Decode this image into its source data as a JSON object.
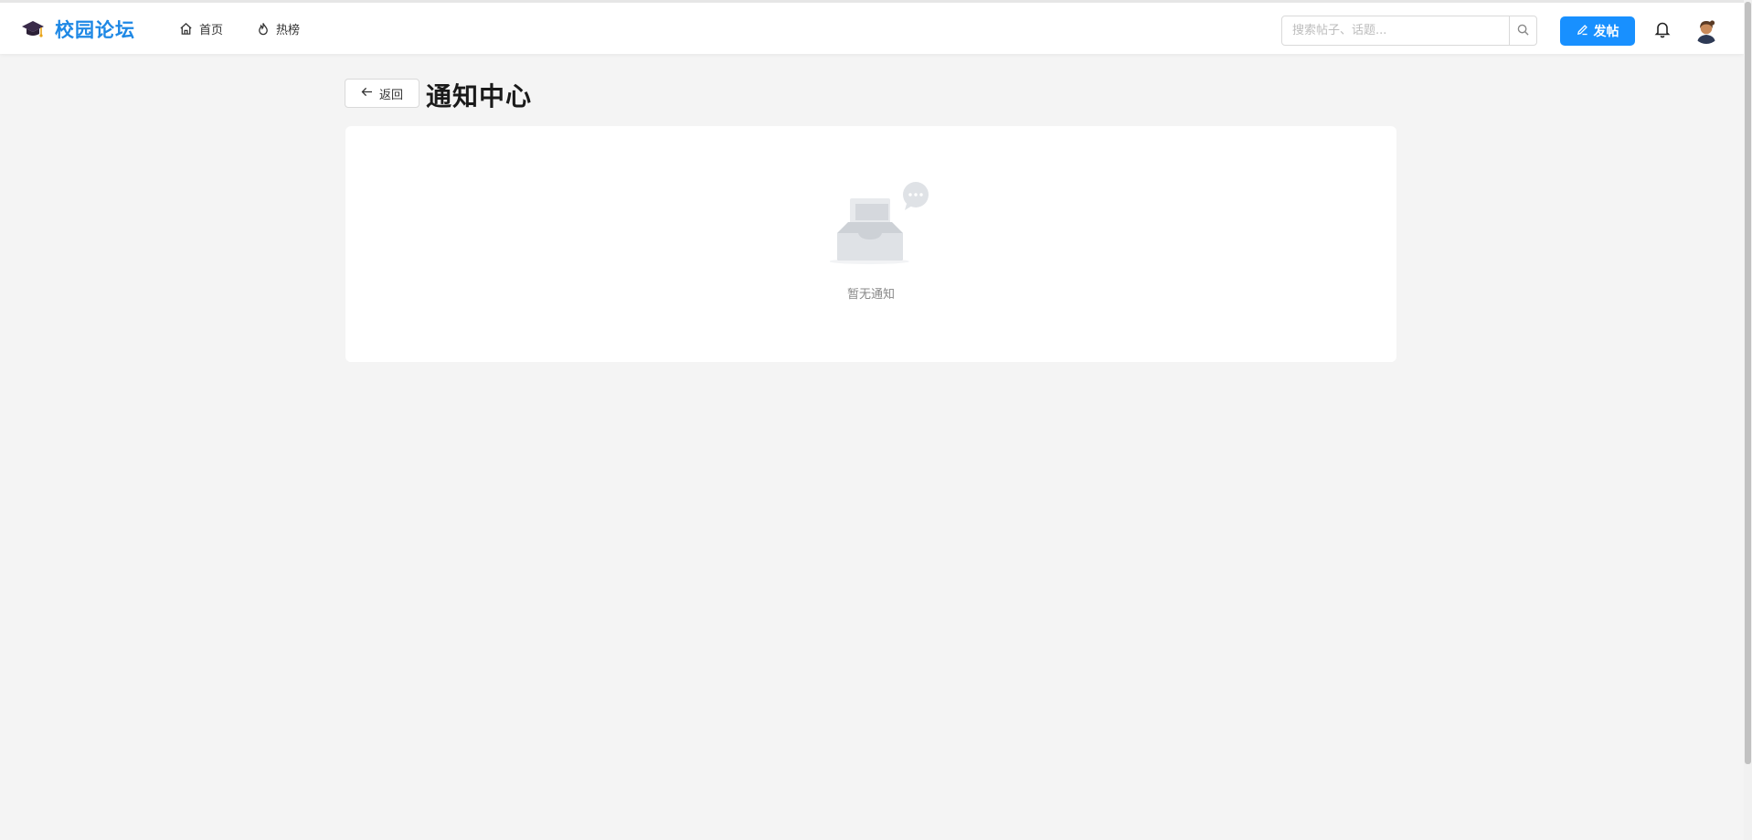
{
  "app": {
    "brand_name": "校园论坛",
    "brand_icon": "graduation-cap-icon",
    "accent_color": "#1890ff"
  },
  "nav": {
    "items": [
      {
        "label": "首页",
        "icon": "home-icon"
      },
      {
        "label": "热榜",
        "icon": "flame-icon"
      }
    ]
  },
  "search": {
    "placeholder": "搜索帖子、话题...",
    "value": "",
    "icon": "search-icon"
  },
  "header_actions": {
    "post_label": "发帖",
    "post_icon": "edit-icon",
    "bell_icon": "bell-icon",
    "avatar_icon": "avatar-icon"
  },
  "page": {
    "back_label": "返回",
    "back_icon": "arrow-left-icon",
    "title": "通知中心"
  },
  "notifications": {
    "items": [],
    "empty_text": "暂无通知",
    "empty_icon": "empty-inbox-icon"
  }
}
